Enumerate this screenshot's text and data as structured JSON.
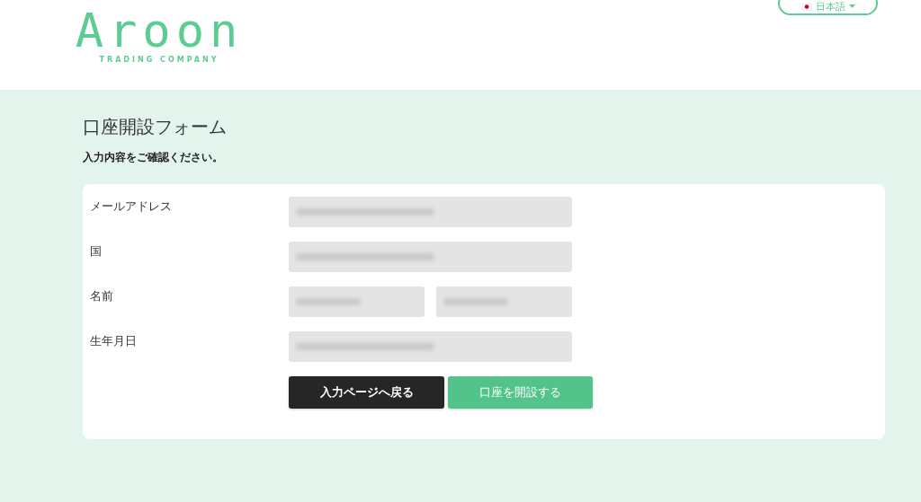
{
  "header": {
    "logo": {
      "name": "Aroon",
      "tagline": "TRADING COMPANY"
    },
    "language": {
      "label": "日本語"
    }
  },
  "title": "口座開設フォーム",
  "subtitle": "入力内容をご確認ください。",
  "fields": [
    {
      "label": "メールアドレス",
      "inputs": [
        {
          "redacted": true
        }
      ]
    },
    {
      "label": "国",
      "inputs": [
        {
          "redacted": true
        }
      ]
    },
    {
      "label": "名前",
      "inputs": [
        {
          "redacted": true
        },
        {
          "redacted": true
        }
      ]
    },
    {
      "label": "生年月日",
      "inputs": [
        {
          "redacted": true
        }
      ]
    }
  ],
  "buttons": [
    {
      "kind": "secondary",
      "label": "入力ページへ戻る"
    },
    {
      "kind": "primary",
      "label": "口座を開設する"
    }
  ]
}
